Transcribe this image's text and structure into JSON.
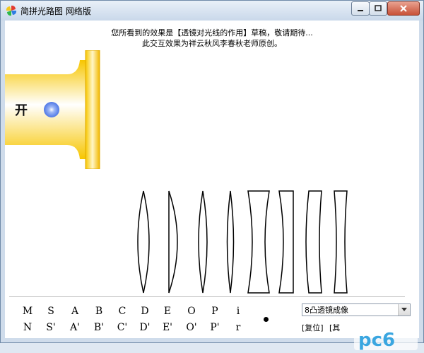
{
  "window": {
    "title": "简拼光路图 网络版",
    "icons": {
      "app": "pinwheel-icon",
      "minimize": "minimize-icon",
      "maximize": "maximize-icon",
      "close": "close-icon"
    }
  },
  "notice": {
    "line1": "您所看到的效果是【透镜对光线的作用】草稿，敬请期待...",
    "line2": "此交互效果为祥云秋风李春秋老师原创。"
  },
  "lamp": {
    "switch_label": "开",
    "colors": {
      "body": "#f7c600",
      "highlight": "#ffffff",
      "bulb": "#6a8ff0"
    }
  },
  "points": {
    "top": [
      "M",
      "S",
      "A",
      "B",
      "C",
      "D",
      "E",
      "O",
      "P",
      "i"
    ],
    "bottom": [
      "N",
      "S'",
      "A'",
      "B'",
      "C'",
      "D'",
      "E'",
      "O'",
      "P'",
      "r"
    ]
  },
  "mode_select": {
    "value": "8凸透镜成像"
  },
  "buttons": {
    "reset": "[复位]",
    "other": "[其"
  },
  "watermark": {
    "text": "pc6"
  }
}
